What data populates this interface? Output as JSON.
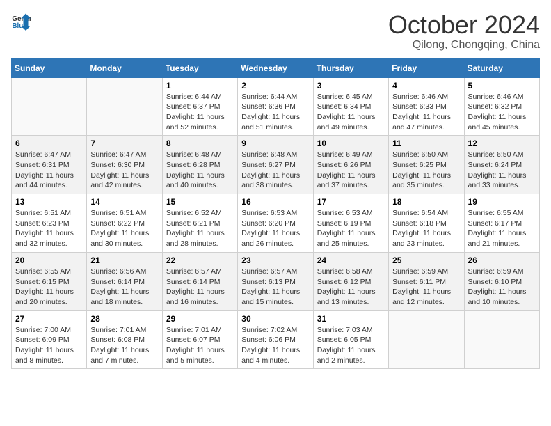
{
  "header": {
    "logo_general": "General",
    "logo_blue": "Blue",
    "month": "October 2024",
    "location": "Qilong, Chongqing, China"
  },
  "weekdays": [
    "Sunday",
    "Monday",
    "Tuesday",
    "Wednesday",
    "Thursday",
    "Friday",
    "Saturday"
  ],
  "weeks": [
    [
      {
        "day": "",
        "info": ""
      },
      {
        "day": "",
        "info": ""
      },
      {
        "day": "1",
        "sunrise": "6:44 AM",
        "sunset": "6:37 PM",
        "daylight": "11 hours and 52 minutes."
      },
      {
        "day": "2",
        "sunrise": "6:44 AM",
        "sunset": "6:36 PM",
        "daylight": "11 hours and 51 minutes."
      },
      {
        "day": "3",
        "sunrise": "6:45 AM",
        "sunset": "6:34 PM",
        "daylight": "11 hours and 49 minutes."
      },
      {
        "day": "4",
        "sunrise": "6:46 AM",
        "sunset": "6:33 PM",
        "daylight": "11 hours and 47 minutes."
      },
      {
        "day": "5",
        "sunrise": "6:46 AM",
        "sunset": "6:32 PM",
        "daylight": "11 hours and 45 minutes."
      }
    ],
    [
      {
        "day": "6",
        "sunrise": "6:47 AM",
        "sunset": "6:31 PM",
        "daylight": "11 hours and 44 minutes."
      },
      {
        "day": "7",
        "sunrise": "6:47 AM",
        "sunset": "6:30 PM",
        "daylight": "11 hours and 42 minutes."
      },
      {
        "day": "8",
        "sunrise": "6:48 AM",
        "sunset": "6:28 PM",
        "daylight": "11 hours and 40 minutes."
      },
      {
        "day": "9",
        "sunrise": "6:48 AM",
        "sunset": "6:27 PM",
        "daylight": "11 hours and 38 minutes."
      },
      {
        "day": "10",
        "sunrise": "6:49 AM",
        "sunset": "6:26 PM",
        "daylight": "11 hours and 37 minutes."
      },
      {
        "day": "11",
        "sunrise": "6:50 AM",
        "sunset": "6:25 PM",
        "daylight": "11 hours and 35 minutes."
      },
      {
        "day": "12",
        "sunrise": "6:50 AM",
        "sunset": "6:24 PM",
        "daylight": "11 hours and 33 minutes."
      }
    ],
    [
      {
        "day": "13",
        "sunrise": "6:51 AM",
        "sunset": "6:23 PM",
        "daylight": "11 hours and 32 minutes."
      },
      {
        "day": "14",
        "sunrise": "6:51 AM",
        "sunset": "6:22 PM",
        "daylight": "11 hours and 30 minutes."
      },
      {
        "day": "15",
        "sunrise": "6:52 AM",
        "sunset": "6:21 PM",
        "daylight": "11 hours and 28 minutes."
      },
      {
        "day": "16",
        "sunrise": "6:53 AM",
        "sunset": "6:20 PM",
        "daylight": "11 hours and 26 minutes."
      },
      {
        "day": "17",
        "sunrise": "6:53 AM",
        "sunset": "6:19 PM",
        "daylight": "11 hours and 25 minutes."
      },
      {
        "day": "18",
        "sunrise": "6:54 AM",
        "sunset": "6:18 PM",
        "daylight": "11 hours and 23 minutes."
      },
      {
        "day": "19",
        "sunrise": "6:55 AM",
        "sunset": "6:17 PM",
        "daylight": "11 hours and 21 minutes."
      }
    ],
    [
      {
        "day": "20",
        "sunrise": "6:55 AM",
        "sunset": "6:15 PM",
        "daylight": "11 hours and 20 minutes."
      },
      {
        "day": "21",
        "sunrise": "6:56 AM",
        "sunset": "6:14 PM",
        "daylight": "11 hours and 18 minutes."
      },
      {
        "day": "22",
        "sunrise": "6:57 AM",
        "sunset": "6:14 PM",
        "daylight": "11 hours and 16 minutes."
      },
      {
        "day": "23",
        "sunrise": "6:57 AM",
        "sunset": "6:13 PM",
        "daylight": "11 hours and 15 minutes."
      },
      {
        "day": "24",
        "sunrise": "6:58 AM",
        "sunset": "6:12 PM",
        "daylight": "11 hours and 13 minutes."
      },
      {
        "day": "25",
        "sunrise": "6:59 AM",
        "sunset": "6:11 PM",
        "daylight": "11 hours and 12 minutes."
      },
      {
        "day": "26",
        "sunrise": "6:59 AM",
        "sunset": "6:10 PM",
        "daylight": "11 hours and 10 minutes."
      }
    ],
    [
      {
        "day": "27",
        "sunrise": "7:00 AM",
        "sunset": "6:09 PM",
        "daylight": "11 hours and 8 minutes."
      },
      {
        "day": "28",
        "sunrise": "7:01 AM",
        "sunset": "6:08 PM",
        "daylight": "11 hours and 7 minutes."
      },
      {
        "day": "29",
        "sunrise": "7:01 AM",
        "sunset": "6:07 PM",
        "daylight": "11 hours and 5 minutes."
      },
      {
        "day": "30",
        "sunrise": "7:02 AM",
        "sunset": "6:06 PM",
        "daylight": "11 hours and 4 minutes."
      },
      {
        "day": "31",
        "sunrise": "7:03 AM",
        "sunset": "6:05 PM",
        "daylight": "11 hours and 2 minutes."
      },
      {
        "day": "",
        "info": ""
      },
      {
        "day": "",
        "info": ""
      }
    ]
  ]
}
